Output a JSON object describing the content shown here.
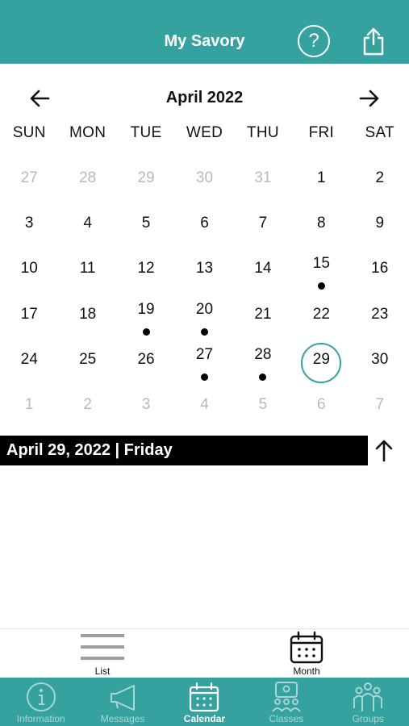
{
  "header": {
    "title": "My Savory",
    "help_icon": "help-icon",
    "share_icon": "share-icon"
  },
  "calendar": {
    "month_label": "April 2022",
    "weekdays": [
      "SUN",
      "MON",
      "TUE",
      "WED",
      "THU",
      "FRI",
      "SAT"
    ],
    "weeks": [
      [
        {
          "d": "27",
          "muted": true
        },
        {
          "d": "28",
          "muted": true
        },
        {
          "d": "29",
          "muted": true
        },
        {
          "d": "30",
          "muted": true
        },
        {
          "d": "31",
          "muted": true
        },
        {
          "d": "1"
        },
        {
          "d": "2"
        }
      ],
      [
        {
          "d": "3"
        },
        {
          "d": "4"
        },
        {
          "d": "5"
        },
        {
          "d": "6"
        },
        {
          "d": "7"
        },
        {
          "d": "8"
        },
        {
          "d": "9"
        }
      ],
      [
        {
          "d": "10"
        },
        {
          "d": "11"
        },
        {
          "d": "12"
        },
        {
          "d": "13"
        },
        {
          "d": "14"
        },
        {
          "d": "15",
          "event": true
        },
        {
          "d": "16"
        }
      ],
      [
        {
          "d": "17"
        },
        {
          "d": "18"
        },
        {
          "d": "19",
          "event": true
        },
        {
          "d": "20",
          "event": true
        },
        {
          "d": "21"
        },
        {
          "d": "22"
        },
        {
          "d": "23"
        }
      ],
      [
        {
          "d": "24"
        },
        {
          "d": "25"
        },
        {
          "d": "26"
        },
        {
          "d": "27",
          "event": true
        },
        {
          "d": "28",
          "event": true
        },
        {
          "d": "29",
          "selected": true
        },
        {
          "d": "30"
        }
      ],
      [
        {
          "d": "1",
          "muted": true
        },
        {
          "d": "2",
          "muted": true
        },
        {
          "d": "3",
          "muted": true
        },
        {
          "d": "4",
          "muted": true
        },
        {
          "d": "5",
          "muted": true
        },
        {
          "d": "6",
          "muted": true
        },
        {
          "d": "7",
          "muted": true
        }
      ]
    ]
  },
  "selected_date_label": "April 29, 2022 | Friday",
  "view_toggle": {
    "list_label": "List",
    "month_label": "Month"
  },
  "tabbar": [
    {
      "label": "Information",
      "icon": "info-icon",
      "active": false
    },
    {
      "label": "Messages",
      "icon": "megaphone-icon",
      "active": false
    },
    {
      "label": "Calendar",
      "icon": "calendar-icon",
      "active": true
    },
    {
      "label": "Classes",
      "icon": "classes-icon",
      "active": false
    },
    {
      "label": "Groups",
      "icon": "groups-icon",
      "active": false
    }
  ],
  "colors": {
    "accent": "#35a29f",
    "muted_text": "#b9b9b9",
    "tab_inactive": "#a9d6d4"
  }
}
